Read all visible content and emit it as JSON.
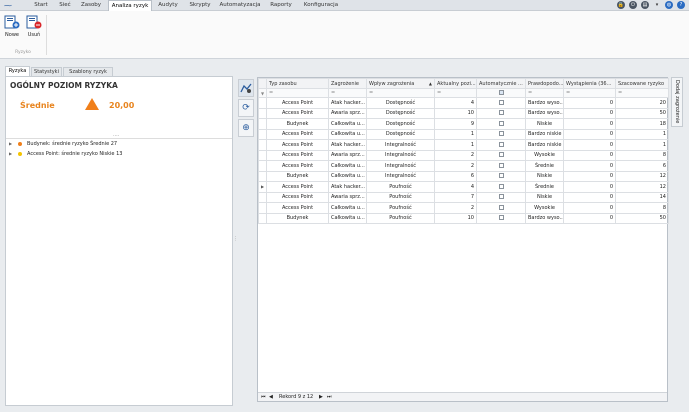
{
  "menu": {
    "app_icon": "app-logo-icon",
    "tabs": [
      {
        "label": "Start"
      },
      {
        "label": "Sieć"
      },
      {
        "label": "Zasoby"
      },
      {
        "label": "Analiza ryzyk"
      },
      {
        "label": "Audyty"
      },
      {
        "label": "Skrypty"
      },
      {
        "label": "Automatyzacja"
      },
      {
        "label": "Raporty"
      },
      {
        "label": "Konfiguracja"
      }
    ],
    "active_tab": "Analiza ryzyk",
    "right_icons": [
      "lock-icon",
      "power-icon",
      "document-icon",
      "dropdown-icon",
      "globe-icon",
      "help-icon"
    ],
    "help_glyph": "?"
  },
  "ribbon": {
    "new_label": "Nowe",
    "delete_label": "Usuń",
    "group_label": "Ryzyko"
  },
  "left": {
    "tabs": [
      "Ryzyka",
      "Statystyki",
      "Szablony ryzyk"
    ],
    "active_tab": "Ryzyka",
    "overall_title": "OGÓLNY POZIOM RYZYKA",
    "level_label": "Średnie",
    "score": "20,00",
    "grip": "....",
    "tree": [
      {
        "label": "Budynek: średnie ryzyko Średnie 27",
        "color": "#f07f1a"
      },
      {
        "label": "Access Point: średnie ryzyko Niskie 13",
        "color": "#f5c400"
      }
    ]
  },
  "side_buttons": [
    "filter-chart-icon",
    "refresh-icon",
    "lifebuoy-icon"
  ],
  "grid": {
    "columns": [
      "Typ zasobu",
      "Zagrożenie",
      "Wpływ zagrożenia",
      "Aktualny pozi...",
      "Automatycznie ...",
      "Prawdopodo...",
      "Wystąpienia (36...",
      "Szacowane ryzyko"
    ],
    "filter_placeholder": "=",
    "sorted_column_arrow": "▲",
    "rows": [
      [
        "Access Point",
        "Atak hacker...",
        "Dostępność",
        "4",
        "",
        "Bardzo wyso...",
        "0",
        "20"
      ],
      [
        "Access Point",
        "Awaria sprz...",
        "Dostępność",
        "10",
        "",
        "Bardzo wyso...",
        "0",
        "50"
      ],
      [
        "Budynek",
        "Całkowita u...",
        "Dostępność",
        "9",
        "",
        "Niskie",
        "0",
        "18"
      ],
      [
        "Access Point",
        "Całkowita u...",
        "Dostępność",
        "1",
        "",
        "Bardzo niskie",
        "0",
        "1"
      ],
      [
        "Access Point",
        "Atak hacker...",
        "Integralność",
        "1",
        "",
        "Bardzo niskie",
        "0",
        "1"
      ],
      [
        "Access Point",
        "Awaria sprz...",
        "Integralność",
        "2",
        "",
        "Wysokie",
        "0",
        "8"
      ],
      [
        "Access Point",
        "Całkowita u...",
        "Integralność",
        "2",
        "",
        "Średnie",
        "0",
        "6"
      ],
      [
        "Budynek",
        "Całkowita u...",
        "Integralność",
        "6",
        "",
        "Niskie",
        "0",
        "12"
      ],
      [
        "Access Point",
        "Atak hacker...",
        "Poufność",
        "4",
        "",
        "Średnie",
        "0",
        "12"
      ],
      [
        "Access Point",
        "Awaria sprz...",
        "Poufność",
        "7",
        "",
        "Niskie",
        "0",
        "14"
      ],
      [
        "Access Point",
        "Całkowita u...",
        "Poufność",
        "2",
        "",
        "Wysokie",
        "0",
        "8"
      ],
      [
        "Budynek",
        "Całkowita u...",
        "Poufność",
        "10",
        "",
        "Bardzo wyso...",
        "0",
        "50"
      ]
    ],
    "current_row_index": 8,
    "footer_record": "Rekord 9 z 12"
  },
  "right_tab": "Dodaj zagrożenie"
}
